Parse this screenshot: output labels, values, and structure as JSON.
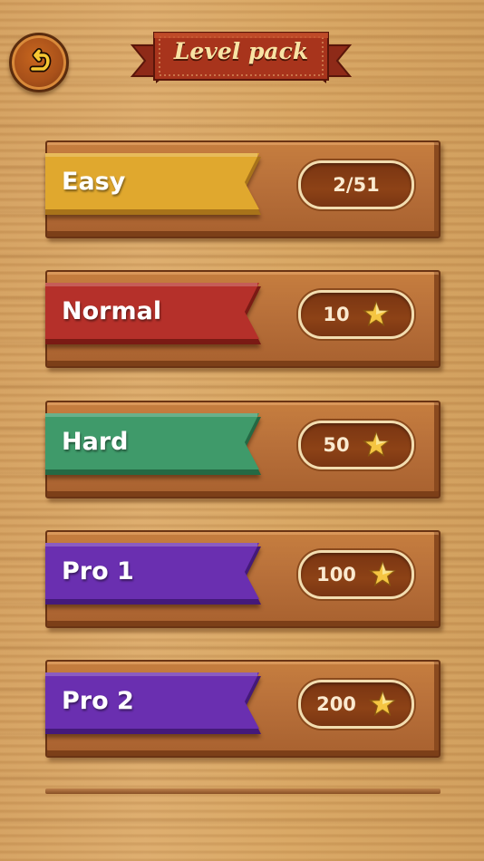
{
  "header": {
    "title": "Level pack",
    "back_icon": "back-arrow-icon"
  },
  "levels": [
    {
      "label": "Easy",
      "value": "2/51",
      "show_star": false,
      "color": "#e0a82e",
      "dark": "#a8731a"
    },
    {
      "label": "Normal",
      "value": "10",
      "show_star": true,
      "color": "#b5302a",
      "dark": "#7a1a14"
    },
    {
      "label": "Hard",
      "value": "50",
      "show_star": true,
      "color": "#3f9a6a",
      "dark": "#246944"
    },
    {
      "label": "Pro 1",
      "value": "100",
      "show_star": true,
      "color": "#6a2fb0",
      "dark": "#44197a"
    },
    {
      "label": "Pro 2",
      "value": "200",
      "show_star": true,
      "color": "#6a2fb0",
      "dark": "#44197a"
    }
  ],
  "colors": {
    "wood_light": "#dcab6c",
    "board": "#b8703a",
    "pill_border": "#f2ddb0",
    "star": "#f5c542"
  }
}
